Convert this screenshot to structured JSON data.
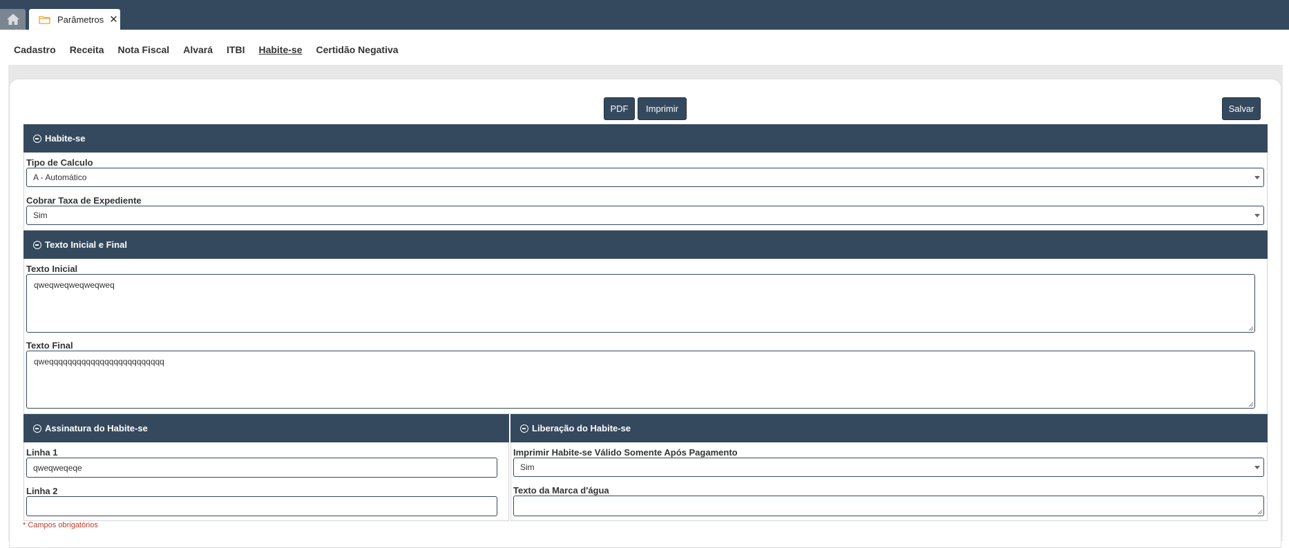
{
  "tabs": {
    "home_icon": "home-icon",
    "active_tab_label": "Parâmetros",
    "close_symbol": "✕"
  },
  "menu": {
    "items": [
      "Cadastro",
      "Receita",
      "Nota Fiscal",
      "Alvará",
      "ITBI",
      "Habite-se",
      "Certidão Negativa"
    ],
    "active": "Habite-se"
  },
  "toolbar": {
    "pdf_label": "PDF",
    "print_label": "Imprimir",
    "save_label": "Salvar"
  },
  "habite_se": {
    "title": "Habite-se",
    "tipo_calculo_label": "Tipo de Calculo",
    "tipo_calculo_value": "A - Automático",
    "cobrar_taxa_label": "Cobrar Taxa de Expediente",
    "cobrar_taxa_value": "Sim"
  },
  "texto": {
    "title": "Texto Inicial e Final",
    "inicial_label": "Texto Inicial",
    "inicial_value": "qweqweqweqweqweq",
    "final_label": "Texto Final",
    "final_value": "qweqqqqqqqqqqqqqqqqqqqqqqqqq"
  },
  "assinatura": {
    "title": "Assinatura do Habite-se",
    "linha1_label": "Linha 1",
    "linha1_value": "qweqweqeqe",
    "linha2_label": "Linha 2",
    "linha2_value": ""
  },
  "liberacao": {
    "title": "Liberação do Habite-se",
    "imprimir_label": "Imprimir Habite-se Válido Somente Após Pagamento",
    "imprimir_value": "Sim",
    "marca_label": "Texto da Marca d'água",
    "marca_value": ""
  },
  "footer": {
    "required_note": "* Campos obrigatórios"
  },
  "colors": {
    "header_bg": "#34495e",
    "required_text": "#c0392b"
  }
}
